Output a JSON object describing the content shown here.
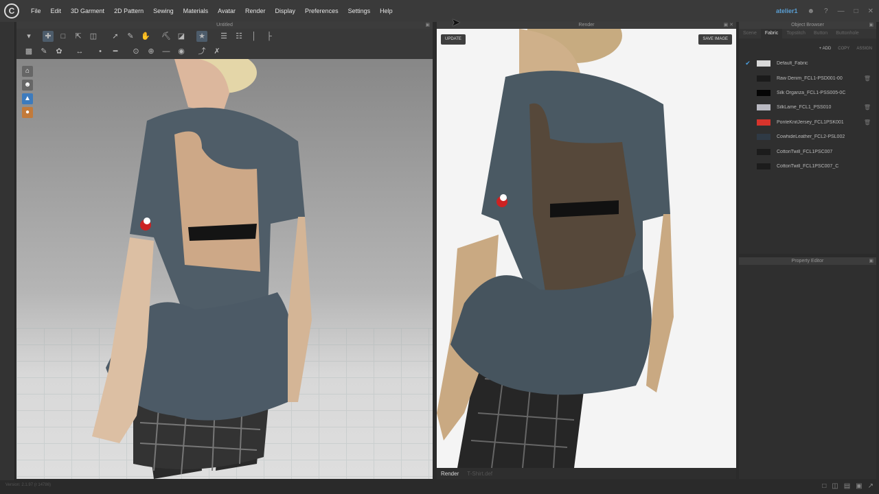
{
  "menu": {
    "items": [
      "File",
      "Edit",
      "3D Garment",
      "2D Pattern",
      "Sewing",
      "Materials",
      "Avatar",
      "Render",
      "Display",
      "Preferences",
      "Settings",
      "Help"
    ],
    "user": "atelier1",
    "logo_text": "C"
  },
  "viewport": {
    "title": "Untitled"
  },
  "render": {
    "title": "Render",
    "update_label": "UPDATE",
    "save_label": "SAVE IMAGE",
    "tabs": [
      "Render",
      "T-Shirt.def"
    ]
  },
  "object_browser": {
    "title": "Object Browser",
    "tabs": [
      "Scene",
      "Fabric",
      "Topstitch",
      "Button",
      "Buttonhole"
    ],
    "active_tab": "Fabric",
    "actions": {
      "add": "+ ADD",
      "copy": "COPY",
      "assign": "ASSIGN"
    },
    "fabrics": [
      {
        "name": "Default_Fabric",
        "color": "#d9d9d9",
        "selected": true,
        "deletable": false
      },
      {
        "name": "Raw Denim_FCL1-PSD001-00",
        "color": "#1b1b1b",
        "selected": false,
        "deletable": true
      },
      {
        "name": "Silk Organza_FCL1-PSS005-0C",
        "color": "#050505",
        "selected": false,
        "deletable": false
      },
      {
        "name": "SilkLame_FCL1_PSS010",
        "color": "#b9b9c2",
        "selected": false,
        "deletable": true
      },
      {
        "name": "PonteKnitJersey_FCL1PSK001",
        "color": "#d8342c",
        "selected": false,
        "deletable": true
      },
      {
        "name": "CowhideLeather_FCL2-PSL002",
        "color": "#2f3a45",
        "selected": false,
        "deletable": false
      },
      {
        "name": "CottonTwill_FCL1PSC007",
        "color": "#1c1c1c",
        "selected": false,
        "deletable": false
      },
      {
        "name": "CottonTwill_FCL1PSC007_C",
        "color": "#1c1c1c",
        "selected": false,
        "deletable": false
      }
    ]
  },
  "property_editor": {
    "title": "Property Editor"
  },
  "status": {
    "version": "Version: 2.1.97   (r 14786)"
  },
  "colors": {
    "accent": "#4a9fe0",
    "garment": "#4c5b66",
    "skin": "#d9b89a"
  }
}
